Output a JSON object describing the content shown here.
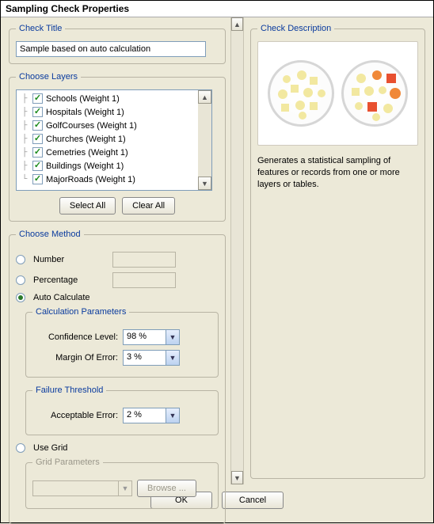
{
  "window": {
    "title": "Sampling Check Properties"
  },
  "checkTitle": {
    "legend": "Check Title",
    "value": "Sample based on auto calculation"
  },
  "chooseLayers": {
    "legend": "Choose Layers",
    "items": [
      {
        "label": "Schools (Weight 1)",
        "checked": true
      },
      {
        "label": "Hospitals (Weight 1)",
        "checked": true
      },
      {
        "label": "GolfCourses (Weight 1)",
        "checked": true
      },
      {
        "label": "Churches (Weight 1)",
        "checked": true
      },
      {
        "label": "Cemetries (Weight 1)",
        "checked": true
      },
      {
        "label": "Buildings (Weight 1)",
        "checked": true
      },
      {
        "label": "MajorRoads (Weight 1)",
        "checked": true
      }
    ],
    "selectAll": "Select All",
    "clearAll": "Clear All"
  },
  "chooseMethod": {
    "legend": "Choose Method",
    "options": {
      "number": {
        "label": "Number",
        "selected": false
      },
      "percentage": {
        "label": "Percentage",
        "selected": false
      },
      "autoCalc": {
        "label": "Auto Calculate",
        "selected": true
      },
      "useGrid": {
        "label": "Use Grid",
        "selected": false
      }
    },
    "calcParams": {
      "legend": "Calculation Parameters",
      "confidenceLabel": "Confidence Level:",
      "confidenceValue": "98 %",
      "marginLabel": "Margin Of Error:",
      "marginValue": "3 %"
    },
    "failureThreshold": {
      "legend": "Failure Threshold",
      "acceptLabel": "Acceptable Error:",
      "acceptValue": "2 %"
    },
    "gridParams": {
      "legend": "Grid Parameters",
      "browse": "Browse ..."
    }
  },
  "checkDescription": {
    "legend": "Check Description",
    "text": "Generates a statistical sampling of features or records from one or more layers or tables."
  },
  "footer": {
    "ok": "OK",
    "cancel": "Cancel"
  }
}
